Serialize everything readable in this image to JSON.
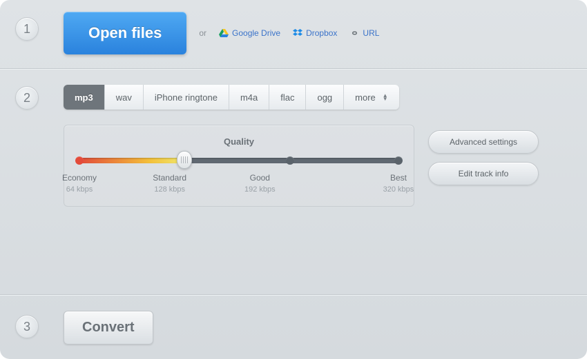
{
  "step1": {
    "num": "1",
    "open_label": "Open files",
    "or": "or",
    "sources": {
      "gdrive": "Google Drive",
      "dropbox": "Dropbox",
      "url": "URL"
    }
  },
  "step2": {
    "num": "2",
    "formats": [
      "mp3",
      "wav",
      "iPhone ringtone",
      "m4a",
      "flac",
      "ogg",
      "more"
    ],
    "active_format_index": 0,
    "quality": {
      "title": "Quality",
      "stops": [
        {
          "name": "Economy",
          "rate": "64 kbps",
          "pos": 0
        },
        {
          "name": "Standard",
          "rate": "128 kbps",
          "pos": 33
        },
        {
          "name": "Good",
          "rate": "192 kbps",
          "pos": 66
        },
        {
          "name": "Best",
          "rate": "320 kbps",
          "pos": 100
        }
      ],
      "current_stop_index": 1
    },
    "advanced_label": "Advanced settings",
    "editinfo_label": "Edit track info"
  },
  "step3": {
    "num": "3",
    "convert_label": "Convert"
  }
}
